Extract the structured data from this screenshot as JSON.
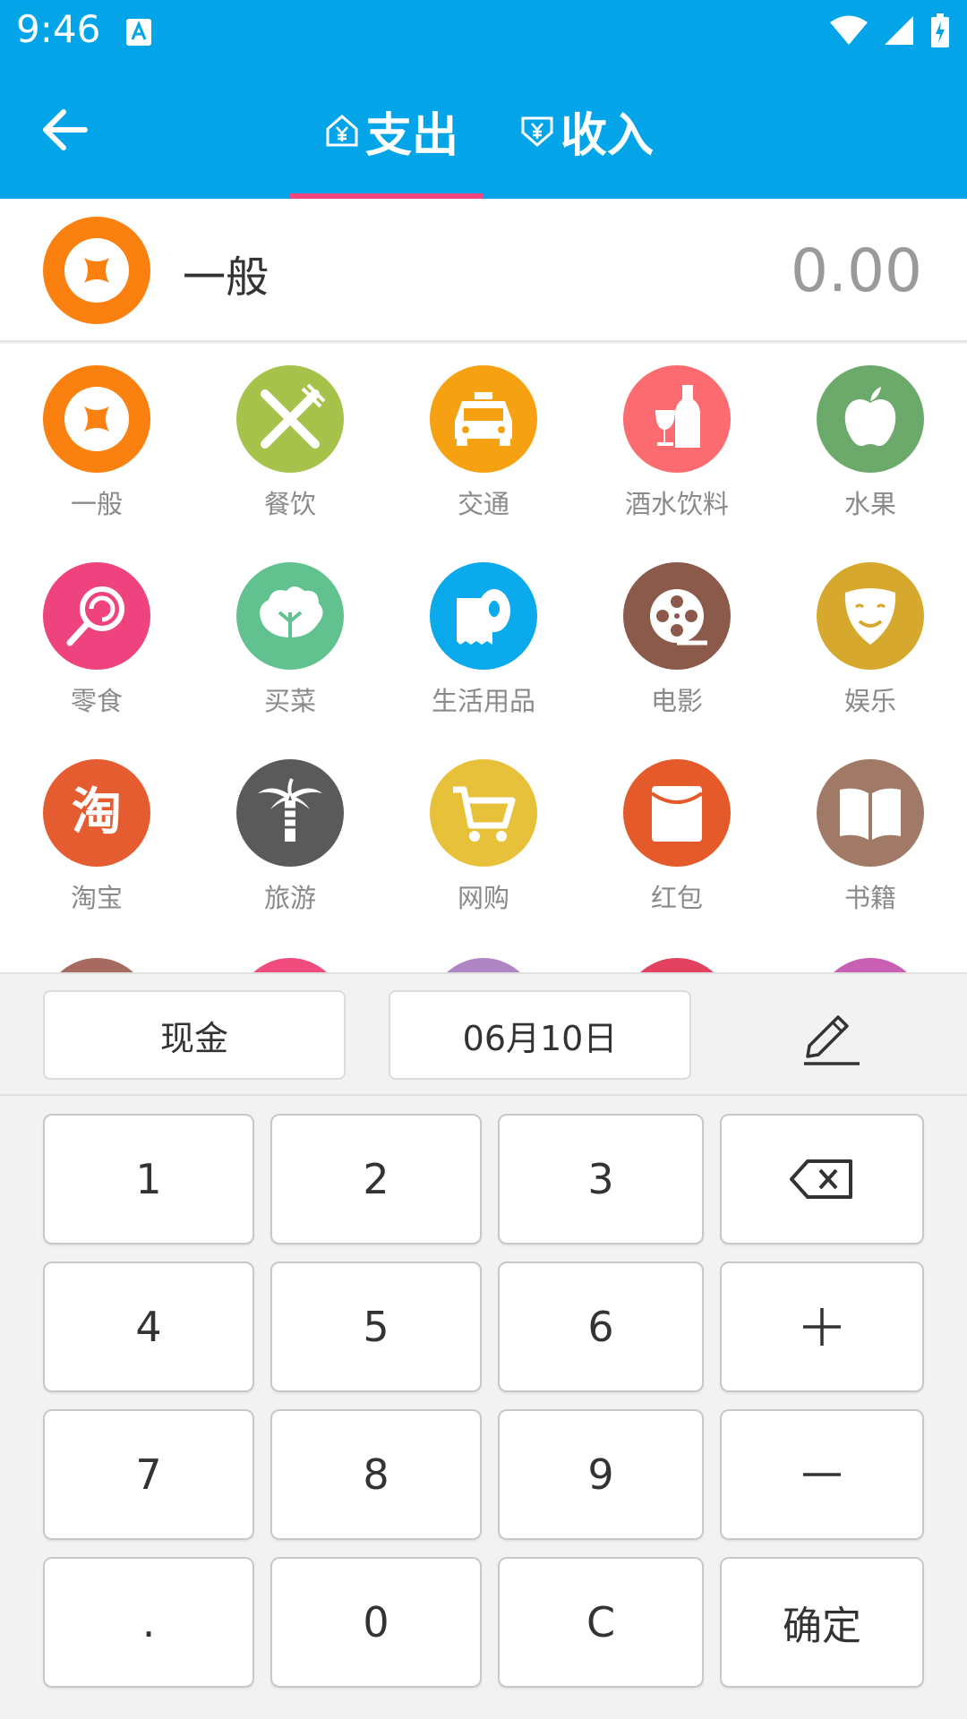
{
  "status_bar": {
    "time": "9:46"
  },
  "tabs": {
    "expense": "支出",
    "income": "收入"
  },
  "selected": {
    "name": "一般",
    "amount": "0.00"
  },
  "categories": [
    {
      "label": "一般",
      "color": "#fa8010",
      "icon": "coin-icon"
    },
    {
      "label": "餐饮",
      "color": "#a6c24a",
      "icon": "fork-knife-icon"
    },
    {
      "label": "交通",
      "color": "#f6a112",
      "icon": "taxi-icon"
    },
    {
      "label": "酒水饮料",
      "color": "#fb6b6f",
      "icon": "wine-bottle-icon"
    },
    {
      "label": "水果",
      "color": "#6caa6b",
      "icon": "apple-icon"
    },
    {
      "label": "零食",
      "color": "#ef437f",
      "icon": "lollipop-icon"
    },
    {
      "label": "买菜",
      "color": "#61c290",
      "icon": "cabbage-icon"
    },
    {
      "label": "生活用品",
      "color": "#0aaaed",
      "icon": "tissue-roll-icon"
    },
    {
      "label": "电影",
      "color": "#8b5a4b",
      "icon": "film-reel-icon"
    },
    {
      "label": "娱乐",
      "color": "#d6a92e",
      "icon": "mask-icon"
    },
    {
      "label": "淘宝",
      "color": "#e65c31",
      "icon": "taobao-icon"
    },
    {
      "label": "旅游",
      "color": "#5a5a5a",
      "icon": "palm-tree-icon"
    },
    {
      "label": "网购",
      "color": "#e8c13a",
      "icon": "cart-icon"
    },
    {
      "label": "红包",
      "color": "#e55a2b",
      "icon": "red-envelope-icon"
    },
    {
      "label": "书籍",
      "color": "#a07a66",
      "icon": "book-icon"
    }
  ],
  "peek_colors": [
    "#a66a60",
    "#f04b7d",
    "#b085c3",
    "#e24160",
    "#c85fb3"
  ],
  "info": {
    "account": "现金",
    "date": "06月10日"
  },
  "keys": {
    "k1": "1",
    "k2": "2",
    "k3": "3",
    "k4": "4",
    "k5": "5",
    "k6": "6",
    "k7": "7",
    "k8": "8",
    "k9": "9",
    "kdot": ".",
    "k0": "0",
    "kc": "C",
    "confirm": "确定"
  }
}
